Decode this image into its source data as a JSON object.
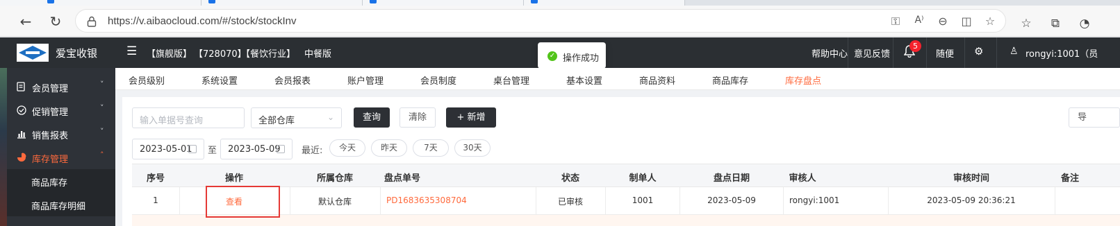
{
  "browser": {
    "url": "https://v.aibaocloud.com/#/stock/stockInv"
  },
  "header": {
    "brand": "爱宝收银",
    "tags": [
      "【旗舰版】",
      "【728070】",
      "【餐饮行业】",
      "中餐版"
    ],
    "help": "帮助中心",
    "feedback": "意见反馈",
    "notification_count": "5",
    "quick": "随便",
    "user": "rongyi:1001（员"
  },
  "toast": {
    "message": "操作成功"
  },
  "sidebar": {
    "items": [
      {
        "label": "会员管理",
        "arrow": "˅"
      },
      {
        "label": "促销管理",
        "arrow": "˅"
      },
      {
        "label": "销售报表",
        "arrow": "˅"
      },
      {
        "label": "库存管理",
        "arrow": "˄"
      }
    ],
    "subitems": [
      "商品库存",
      "商品库存明细"
    ]
  },
  "topnav": {
    "tabs": [
      "会员级别",
      "系统设置",
      "会员报表",
      "账户管理",
      "会员制度",
      "桌台管理",
      "基本设置",
      "商品资料",
      "商品库存",
      "库存盘点"
    ],
    "active_index": 9
  },
  "filters": {
    "order_placeholder": "输入单据号查询",
    "warehouse": "全部仓库",
    "query_button": "查询",
    "clear_button": "清除",
    "add_button": "新增",
    "add_prefix": "+",
    "export_button": "导",
    "date_from": "2023-05-01",
    "date_sep": "至",
    "date_to": "2023-05-09",
    "recent_label": "最近:",
    "quick_ranges": [
      "今天",
      "昨天",
      "7天",
      "30天"
    ]
  },
  "table": {
    "columns": [
      "序号",
      "操作",
      "所属仓库",
      "盘点单号",
      "状态",
      "制单人",
      "盘点日期",
      "审核人",
      "审核时间",
      "备注"
    ],
    "rows": [
      {
        "index": "1",
        "action": "查看",
        "warehouse": "默认仓库",
        "order_no": "PD1683635308704",
        "status": "已审核",
        "creator": "1001",
        "date": "2023-05-09",
        "reviewer": "rongyi:1001",
        "review_time": "2023-05-09 20:36:21",
        "note": ""
      }
    ]
  },
  "colors": {
    "accent": "#ff6a3d",
    "header_bg": "#2b2f33",
    "sidebar_bg": "#2e3238",
    "highlight_box": "#e53935",
    "success": "#52c41a",
    "badge": "#f5222d"
  }
}
